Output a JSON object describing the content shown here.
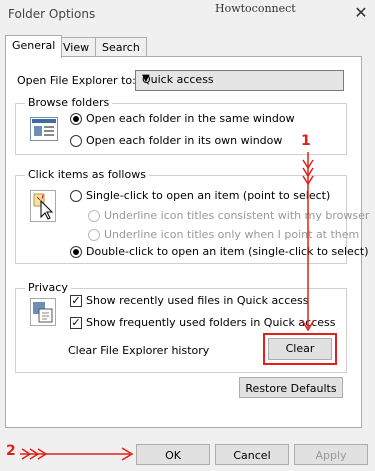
{
  "window": {
    "title": "Folder Options",
    "watermark": "Howtoconnect",
    "close_glyph": "✕"
  },
  "tabs": [
    {
      "label": "General"
    },
    {
      "label": "View"
    },
    {
      "label": "Search"
    }
  ],
  "open_explorer": {
    "label": "Open File Explorer to:",
    "value": "Quick access"
  },
  "browse": {
    "title": "Browse folders",
    "options": [
      "Open each folder in the same window",
      "Open each folder in its own window"
    ]
  },
  "click_items": {
    "title": "Click items as follows",
    "single": "Single-click to open an item (point to select)",
    "underline_consistent": "Underline icon titles consistent with my browser",
    "underline_point": "Underline icon titles only when I point at them",
    "double": "Double-click to open an item (single-click to select)"
  },
  "privacy": {
    "title": "Privacy",
    "recent_files": "Show recently used files in Quick access",
    "frequent_folders": "Show frequently used folders in Quick access",
    "clear_label": "Clear File Explorer history",
    "clear_button": "Clear"
  },
  "buttons": {
    "restore": "Restore Defaults",
    "ok": "OK",
    "cancel": "Cancel",
    "apply": "Apply"
  },
  "annotations": {
    "one": "1",
    "two": "2"
  },
  "colors": {
    "annotation": "#e0201b"
  }
}
